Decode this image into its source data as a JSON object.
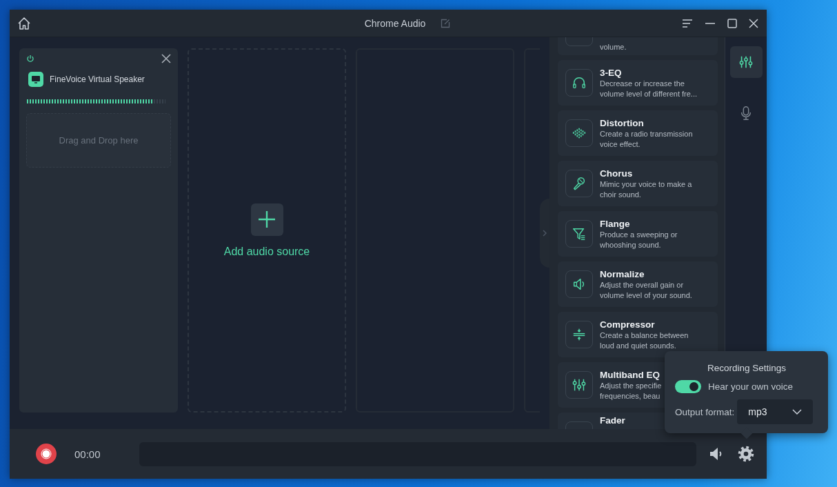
{
  "window": {
    "title": "Chrome Audio"
  },
  "sources": [
    {
      "kind": "device",
      "name": "FineVoice Virtual Speaker",
      "on": true,
      "level": 0.91,
      "drop_hint": "Drag and Drop here"
    },
    {
      "kind": "add",
      "label": "Add audio source"
    },
    {
      "kind": "empty"
    },
    {
      "kind": "empty"
    }
  ],
  "effects": [
    {
      "kind": "blank",
      "lines": [
        "volume."
      ]
    },
    {
      "kind": "headphones",
      "title": "3-EQ",
      "lines": [
        "Decrease or increase the",
        "volume level of different fre..."
      ]
    },
    {
      "kind": "wave",
      "title": "Distortion",
      "lines": [
        "Create a radio transmission",
        "voice effect."
      ]
    },
    {
      "kind": "microphone",
      "title": "Chorus",
      "lines": [
        "Mimic your voice to make a",
        "choir sound."
      ]
    },
    {
      "kind": "filter",
      "title": "Flange",
      "lines": [
        "Produce a sweeping or",
        "whooshing sound."
      ]
    },
    {
      "kind": "speaker",
      "title": "Normalize",
      "lines": [
        "Adjust the overall gain or",
        "volume level of your sound."
      ]
    },
    {
      "kind": "compress",
      "title": "Compressor",
      "lines": [
        "Create a balance between",
        "loud and quiet sounds."
      ]
    },
    {
      "kind": "sliders",
      "title": "Multiband EQ",
      "lines": [
        "Adjust the specifie",
        "frequencies, beau"
      ]
    },
    {
      "kind": "blank",
      "title": "Fader"
    }
  ],
  "rail": [
    {
      "kind": "effects",
      "selected": true
    },
    {
      "kind": "microphone",
      "selected": false
    }
  ],
  "bottom_bar": {
    "time": "00:00"
  },
  "popup": {
    "title": "Recording Settings",
    "toggle": {
      "label": "Hear your own voice",
      "on": true
    },
    "format": {
      "label": "Output format:",
      "value": "mp3"
    }
  }
}
